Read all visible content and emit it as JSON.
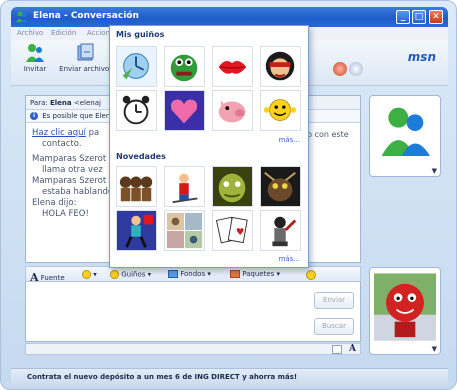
{
  "window": {
    "title": "Elena - Conversación",
    "minimize_glyph": "_",
    "maximize_glyph": "□",
    "close_glyph": "✕"
  },
  "menu": {
    "items": [
      "Archivo",
      "Edición",
      "Acciones"
    ]
  },
  "toolbar": {
    "invite_label": "Invitar",
    "send_files_label": "Enviar archivos",
    "logo": "msn"
  },
  "conversation": {
    "to_label": "Para:",
    "to_name": "Elena",
    "to_email": "<elenaj",
    "info_text": "Es posible que Elena",
    "link_text": "Haz clic aquí",
    "link_suffix": "pa",
    "right_fragment": "to con este",
    "contact_text": "contacto.",
    "messages": [
      {
        "sender": "Mamparas Szerot",
        "text": "llama otra vez"
      },
      {
        "sender": "Mamparas Szerot",
        "text": "estaba hablando"
      },
      {
        "sender": "Elena dijo:",
        "text": "HOLA FEO!"
      }
    ]
  },
  "format_bar": {
    "font_label": "Fuente",
    "winks_label": "Guiños",
    "backgrounds_label": "Fondos",
    "packs_label": "Paquetes"
  },
  "input": {
    "send_label": "Enviar",
    "search_label": "Buscar"
  },
  "status_bar": {
    "ad_text": "Contrata el nuevo depósito a un mes 6 de ING DIRECT y ahorra más!"
  },
  "winks_popup": {
    "my_winks_title": "Mis guiños",
    "my_winks": [
      "clock-wink",
      "frog-wink",
      "kiss-lips-wink",
      "masked-girl-wink",
      "alarm-clock-wink",
      "heart-wink",
      "pink-pig-wink",
      "yellow-smiley-wink"
    ],
    "more_label": "más...",
    "new_title": "Novedades",
    "new_winks": [
      "three-monkeys-wink",
      "skier-wink",
      "ogre-face-wink",
      "dark-creature-wink",
      "dancer-wink",
      "faces-collage-wink",
      "playing-cards-wink",
      "knight-wink"
    ],
    "more_label_2": "más..."
  }
}
